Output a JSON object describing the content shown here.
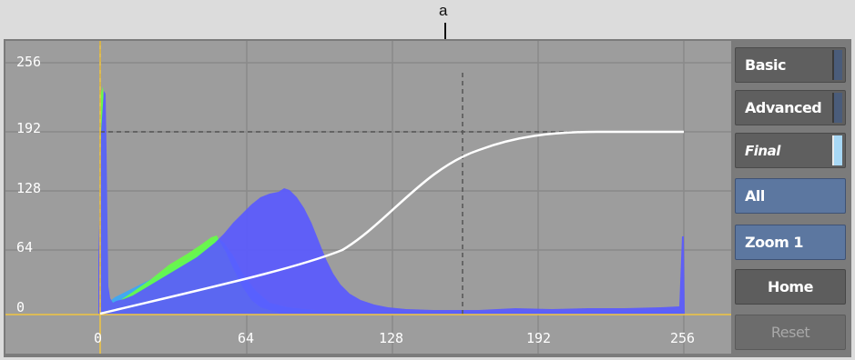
{
  "callout": {
    "label": "a"
  },
  "curve_editor": {
    "y_ticks": [
      "256",
      "192",
      "128",
      "64",
      "0"
    ],
    "x_ticks": [
      "0",
      "64",
      "128",
      "192",
      "256"
    ],
    "colors": {
      "background": "#9d9d9d",
      "grid": "#8a8a8a",
      "axis": "#f2c540",
      "curve": "#ffffff",
      "histogram_blue": "#5a5aff",
      "histogram_green": "#66ff44",
      "histogram_cyan": "#33aaff"
    }
  },
  "sidebar": {
    "basic": "Basic",
    "advanced": "Advanced",
    "final": "Final",
    "all": "All",
    "zoom": "Zoom 1",
    "home": "Home",
    "reset": "Reset"
  }
}
